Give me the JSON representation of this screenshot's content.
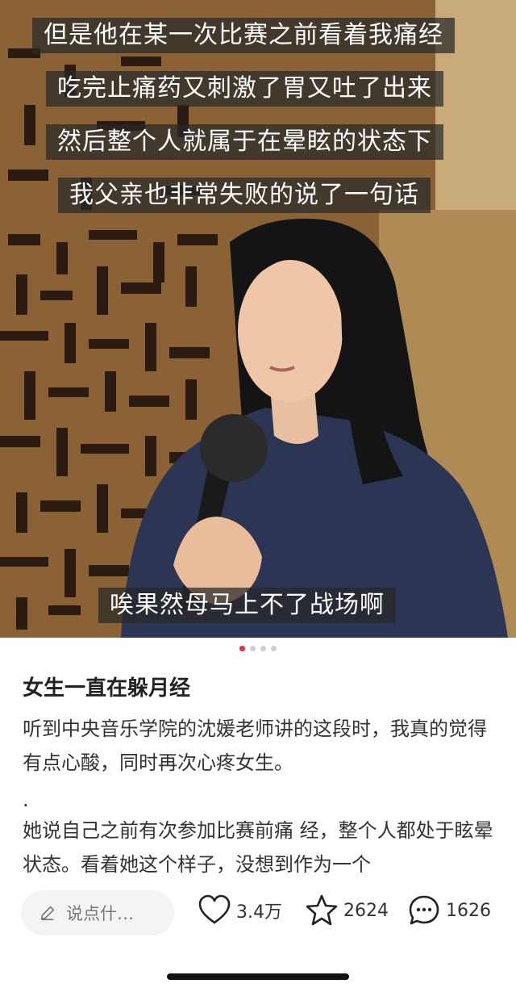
{
  "subtitles": {
    "line1": "但是他在某一次比赛之前看着我痛经",
    "line2": "吃完止痛药又刺激了胃又吐了出来",
    "line3": "然后整个人就属于在晕眩的状态下",
    "line4": "我父亲也非常失败的说了一句话",
    "line5": "唉果然母马上不了战场啊"
  },
  "carousel": {
    "current": 1,
    "total": 4
  },
  "post": {
    "title": "女生一直在躲月经",
    "para1": "听到中央音乐学院的沈媛老师讲的这段时，我真的觉得有点心酸，同时再次心疼女生。",
    "para2": ".",
    "para3": "她说自己之前有次参加比赛前痛 经，整个人都处于眩晕状态。看着她这个样子，没想到作为一个"
  },
  "bottom_bar": {
    "comment_placeholder": "说点什…",
    "likes": "3.4万",
    "favorites": "2624",
    "comments": "1626"
  },
  "colors": {
    "accent": "#ff2442",
    "subtitle_bg": "#3a3a3a",
    "shirt": "#2c3553"
  }
}
